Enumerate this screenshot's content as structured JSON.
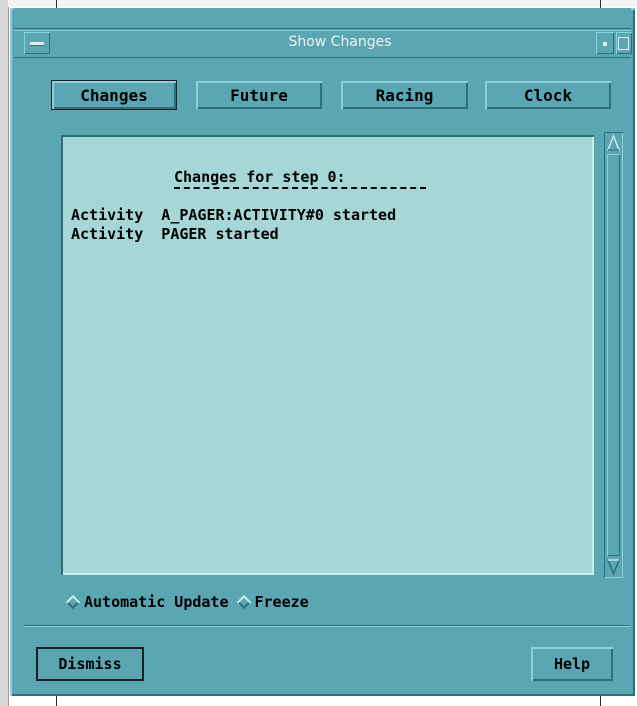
{
  "window": {
    "title": "Show Changes"
  },
  "tabs": [
    {
      "label": "Changes"
    },
    {
      "label": "Future"
    },
    {
      "label": "Racing"
    },
    {
      "label": "Clock"
    }
  ],
  "output": {
    "header": "Changes for step 0:",
    "lines": [
      "Activity  A_PAGER:ACTIVITY#0 started",
      "Activity  PAGER started"
    ]
  },
  "options": {
    "automatic_update": "Automatic Update",
    "freeze": "Freeze"
  },
  "buttons": {
    "dismiss": "Dismiss",
    "help": "Help"
  }
}
